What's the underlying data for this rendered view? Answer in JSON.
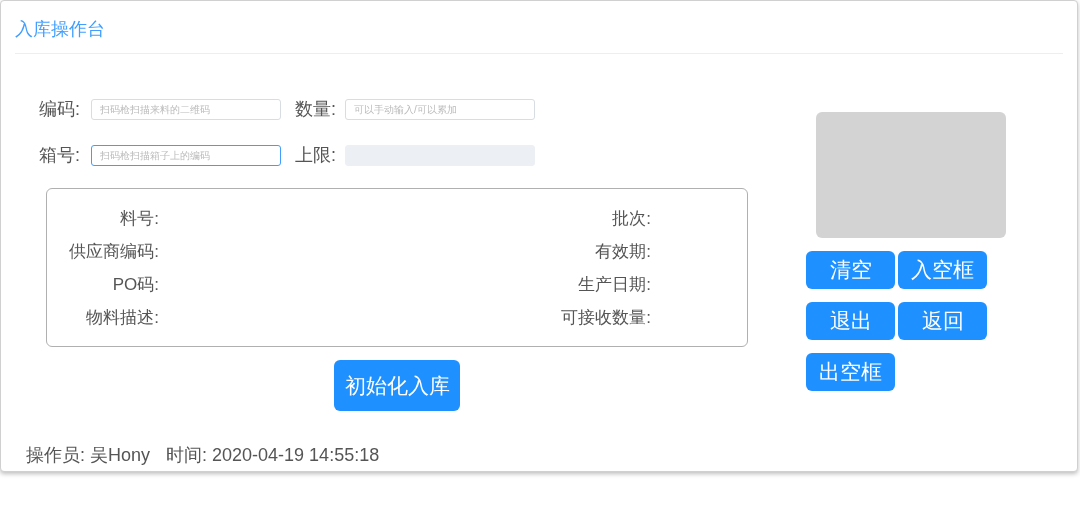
{
  "title": "入库操作台",
  "fields": [
    {
      "label": "编码:",
      "placeholder": "扫码枪扫描来料的二维码",
      "focused": false,
      "disabled": false
    },
    {
      "label": "数量:",
      "placeholder": "可以手动输入/可以累加",
      "focused": false,
      "disabled": false
    },
    {
      "label": "箱号:",
      "placeholder": "扫码枪扫描箱子上的编码",
      "focused": true,
      "disabled": false
    },
    {
      "label": "上限:",
      "disabled": true,
      "focused": false
    }
  ],
  "info_left": [
    "料号:",
    "供应商编码:",
    "PO码:",
    "物料描述:"
  ],
  "info_right": [
    "批次:",
    "有效期:",
    "生产日期:",
    "可接收数量:"
  ],
  "init_button": "初始化入库",
  "side_buttons": [
    "清空",
    "入空框",
    "退出",
    "返回",
    "出空框"
  ],
  "footer": {
    "operator": "操作员: 吴Hony",
    "time": "时间: 2020-04-19 14:55:18"
  }
}
